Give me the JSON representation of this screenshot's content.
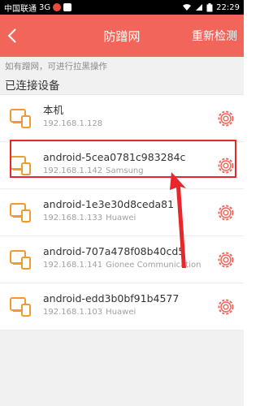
{
  "status_bar": {
    "carrier": "中国联通",
    "network": "3G",
    "time": "22:29"
  },
  "header": {
    "title": "防蹭网",
    "back_icon": "chevron-left-icon",
    "action_label": "重新检测"
  },
  "hint": "如有蹭网，可进行拉黑操作",
  "section_title": "已连接设备",
  "devices": [
    {
      "name": "本机",
      "ip": "192.168.1.128",
      "vendor": ""
    },
    {
      "name": "android-5cea0781c983284c",
      "ip": "192.168.1.142",
      "vendor": "Samsung"
    },
    {
      "name": "android-1e3e30d8ceda81",
      "ip": "192.168.1.133",
      "vendor": "Huawei"
    },
    {
      "name": "android-707a478f08b40cd5",
      "ip": "192.168.1.141",
      "vendor": "Gionee Communication"
    },
    {
      "name": "android-edd3b0bf91b4577",
      "ip": "192.168.1.103",
      "vendor": "Huawei"
    }
  ],
  "colors": {
    "accent": "#f2655a",
    "device_icon": "#f39a2e",
    "highlight": "#e8272c"
  }
}
